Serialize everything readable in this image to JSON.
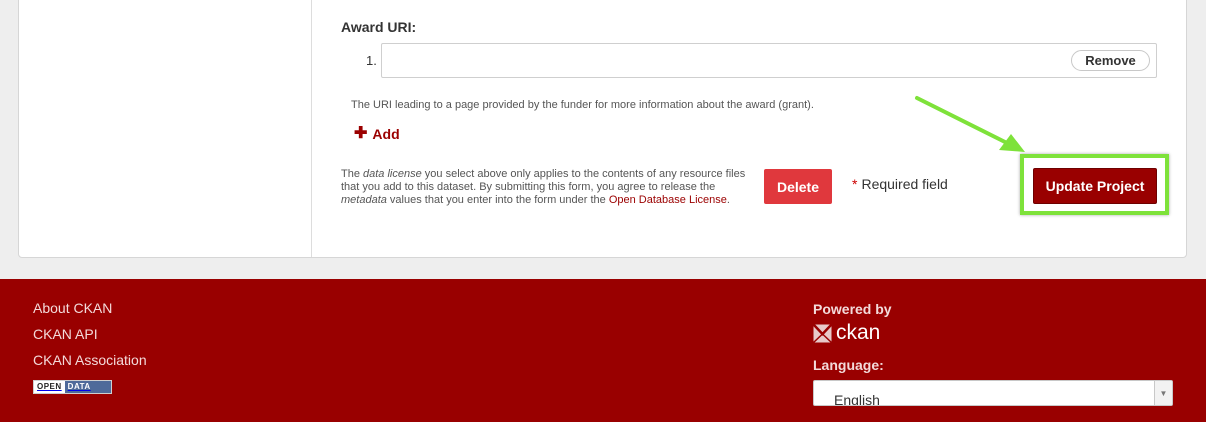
{
  "form": {
    "award_uri_label": "Award URI:",
    "row_number": "1.",
    "uri_value": "",
    "remove_label": "Remove",
    "help_text": "The URI leading to a page provided by the funder for more information about the award (grant).",
    "add_label": "Add",
    "license_note": {
      "part1": "The ",
      "data_license": "data license",
      "part2": " you select above only applies to the contents of any resource files that you add to this dataset. By submitting this form, you agree to release the ",
      "metadata": "metadata",
      "part3": " values that you enter into the form under the ",
      "link": "Open Database License",
      "part4": "."
    },
    "delete_label": "Delete",
    "required_star": "*",
    "required_label": "Required field",
    "update_label": "Update Project"
  },
  "annotation": {
    "highlight_color": "#7ee23a",
    "arrow_color": "#7ee23a"
  },
  "footer": {
    "links": [
      "About CKAN",
      "CKAN API",
      "CKAN Association"
    ],
    "open_data_badge": [
      "OPEN",
      "DATA"
    ],
    "powered_by": "Powered by",
    "ckan_logo_text": "ckan",
    "language_label": "Language:",
    "language_value": "English",
    "background": "#990000"
  }
}
